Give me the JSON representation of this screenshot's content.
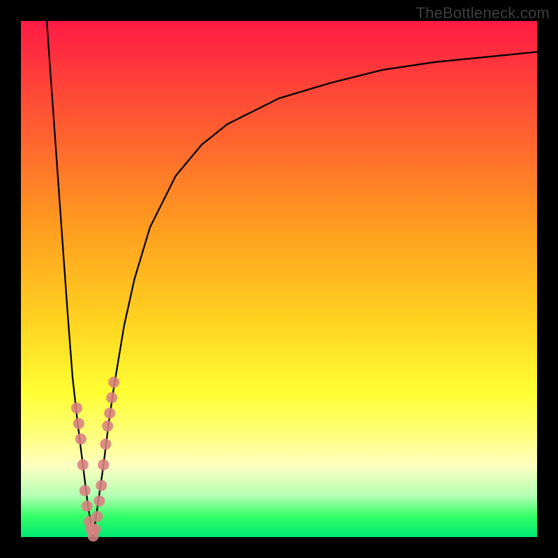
{
  "attribution": "TheBottleneck.com",
  "colors": {
    "frame": "#000000",
    "curve": "#000000",
    "marker": "#d88080",
    "gradient_top": "#ff1a44",
    "gradient_bottom": "#00e673"
  },
  "chart_data": {
    "type": "line",
    "title": "",
    "xlabel": "",
    "ylabel": "",
    "xlim": [
      0,
      100
    ],
    "ylim": [
      0,
      100
    ],
    "x_optimum": 14,
    "series": [
      {
        "name": "bottleneck-curve",
        "x": [
          5,
          6,
          7,
          8,
          9,
          10,
          11,
          12,
          13,
          14,
          15,
          16,
          17,
          18,
          19,
          20,
          22,
          25,
          30,
          35,
          40,
          50,
          60,
          70,
          80,
          90,
          100
        ],
        "values": [
          100,
          86,
          72,
          58,
          44,
          31,
          22,
          14,
          6,
          0,
          7,
          14,
          22,
          29,
          35,
          41,
          50,
          60,
          70,
          76,
          80,
          85,
          88,
          90.5,
          92,
          93,
          94
        ]
      }
    ],
    "markers": {
      "name": "sample-points",
      "x": [
        10.8,
        11.2,
        11.6,
        12.0,
        12.4,
        12.8,
        13.2,
        13.6,
        14.0,
        14.4,
        14.8,
        15.2,
        15.6,
        16.0,
        16.4,
        16.8,
        17.2,
        17.6,
        18.0
      ],
      "values": [
        25.0,
        22.0,
        19.0,
        14.0,
        9.0,
        6.0,
        3.0,
        1.5,
        0.2,
        1.5,
        4.0,
        7.0,
        10.0,
        14.0,
        18.0,
        21.5,
        24.0,
        27.0,
        30.0
      ]
    }
  }
}
